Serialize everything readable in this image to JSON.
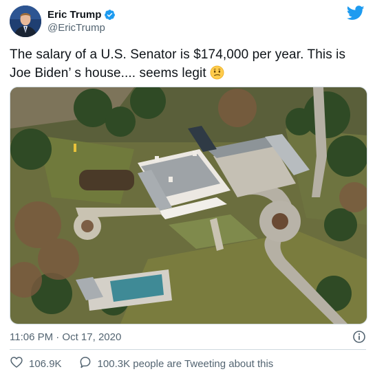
{
  "author": {
    "display_name": "Eric Trump",
    "handle": "@EricTrump",
    "verified": true,
    "avatar_icon": "avatar-photo"
  },
  "tweet": {
    "line1": "The salary of a U.S. Senator is $174,000 per year. This is",
    "line2": "Joe Biden’  s house.... seems legit",
    "emoji": "confused-face-emoji"
  },
  "photo": {
    "description_icon": "aerial-house-photo"
  },
  "meta": {
    "timestamp": "11:06 PM · Oct 17, 2020",
    "info_icon": "info-icon"
  },
  "actions": {
    "likes": "106.9K",
    "tweeting": "100.3K people are Tweeting about this"
  },
  "colors": {
    "brand_blue": "#1d9bf0",
    "text": "#0f1419",
    "secondary": "#536471",
    "border": "#cfd9de"
  }
}
